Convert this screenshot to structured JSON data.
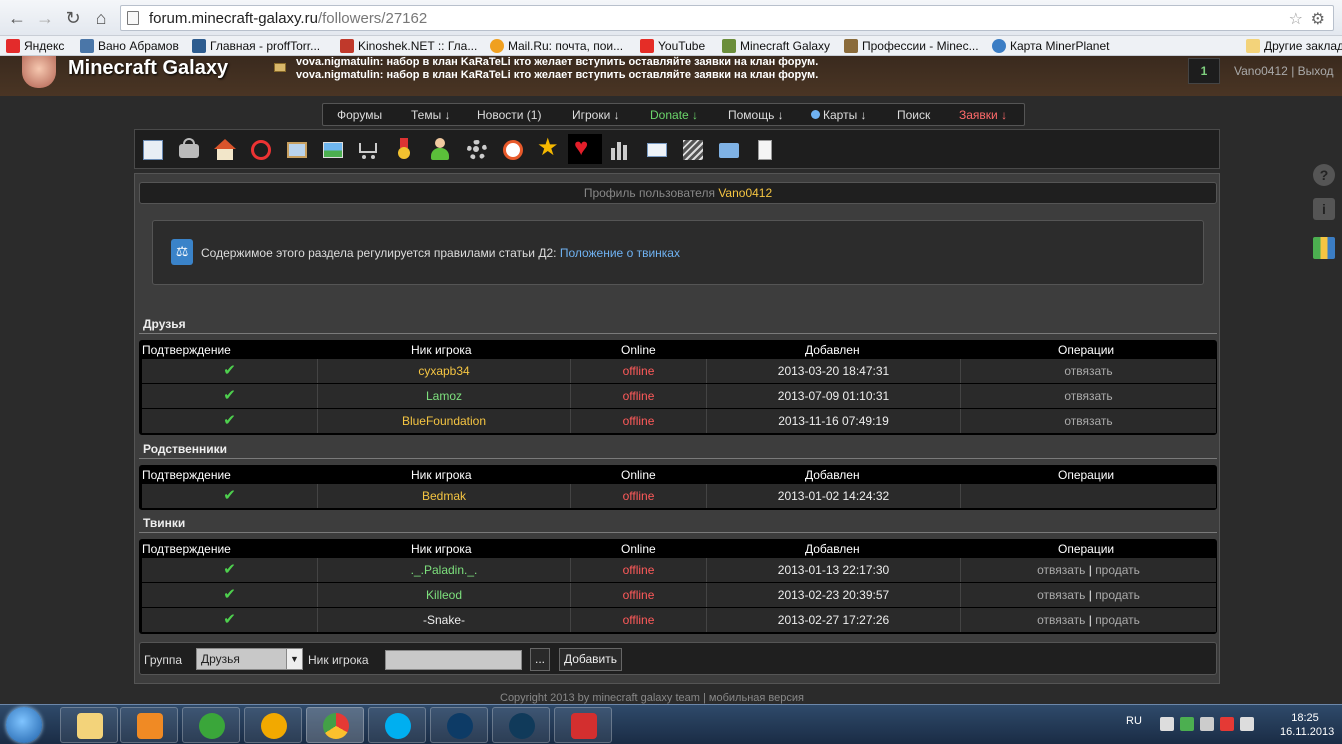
{
  "browser": {
    "url_host": "forum.minecraft-galaxy.ru",
    "url_path": "/followers/27162",
    "bookmarks": [
      {
        "label": "Яндекс",
        "color": "#e32b2b"
      },
      {
        "label": "Вано Абрамов",
        "color": "#4a76a8"
      },
      {
        "label": "Главная - proffTorr...",
        "color": "#2d5c8f"
      },
      {
        "label": "Kinoshek.NET :: Гла...",
        "color": "#c0392b"
      },
      {
        "label": "Mail.Ru: почта, пои...",
        "color": "#f0a020"
      },
      {
        "label": "YouTube",
        "color": "#e52d27"
      },
      {
        "label": "Minecraft Galaxy",
        "color": "#6b8e3b"
      },
      {
        "label": "Профессии - Minec...",
        "color": "#8a6b3b"
      },
      {
        "label": "Карта MinerPlanet",
        "color": "#3b7dc4"
      }
    ],
    "other_bookmarks": "Другие заклад"
  },
  "site": {
    "logo": "Minecraft Galaxy",
    "news": [
      "vova.nigmatulin: набор в клан KaRaTeLi кто желает вступить оставляйте заявки на клан форум.",
      "vova.nigmatulin: набор в клан KaRaTeLi кто желает вступить оставляйте заявки на клан форум."
    ],
    "notify_count": "1",
    "username": "Vano0412",
    "separator": "|",
    "logout": "Выход"
  },
  "nav": {
    "forums": "Форумы",
    "topics": "Темы ↓",
    "news": "Новости (1)",
    "players": "Игроки ↓",
    "donate": "Donate ↓",
    "help": "Помощь ↓",
    "maps": "Карты ↓",
    "search": "Поиск",
    "requests": "Заявки ↓"
  },
  "icons": [
    "profile-card-icon",
    "lock-icon",
    "home-icon",
    "ban-icon",
    "picture-frame-icon",
    "landscape-icon",
    "cart-icon",
    "medal-icon",
    "user-icon",
    "gear-icon",
    "clock-icon",
    "star-icon",
    "heart-icon",
    "stats-icon",
    "mail-icon",
    "notes-icon",
    "folder-icon",
    "document-icon"
  ],
  "profile": {
    "label": "Профиль пользователя",
    "name": "Vano0412"
  },
  "notice": {
    "text": "Содержимое этого раздела регулируется правилами статьи Д2:",
    "link": "Положение о твинках"
  },
  "columns": {
    "confirm": "Подтверждение",
    "nick": "Ник игрока",
    "online": "Online",
    "added": "Добавлен",
    "ops": "Операции"
  },
  "sections": {
    "friends": {
      "title": "Друзья",
      "rows": [
        {
          "nick": "cyxapb34",
          "status": "offline",
          "added": "2013-03-20 18:47:31",
          "op1": "отвязать"
        },
        {
          "nick": "Lamoz",
          "status": "offline",
          "added": "2013-07-09 01:10:31",
          "op1": "отвязать"
        },
        {
          "nick": "BlueFoundation",
          "status": "offline",
          "added": "2013-11-16 07:49:19",
          "op1": "отвязать"
        }
      ]
    },
    "relatives": {
      "title": "Родственники",
      "rows": [
        {
          "nick": "Bedmak",
          "status": "offline",
          "added": "2013-01-02 14:24:32"
        }
      ]
    },
    "twinks": {
      "title": "Твинки",
      "rows": [
        {
          "nick": "._.Paladin._.",
          "status": "offline",
          "added": "2013-01-13 22:17:30",
          "op1": "отвязать",
          "sep": "|",
          "op2": "продать"
        },
        {
          "nick": "Killeod",
          "status": "offline",
          "added": "2013-02-23 20:39:57",
          "op1": "отвязать",
          "sep": "|",
          "op2": "продать"
        },
        {
          "nick": "-Snake-",
          "status": "offline",
          "added": "2013-02-27 17:27:26",
          "op1": "отвязать",
          "sep": "|",
          "op2": "продать"
        }
      ]
    }
  },
  "form": {
    "group_label": "Группа",
    "group_value": "Друзья",
    "nick_label": "Ник игрока",
    "browse": "...",
    "add": "Добавить"
  },
  "footer": {
    "copyright": "Copyright 2013 by minecraft galaxy team",
    "sep": "|",
    "mobile": "мобильная версия"
  },
  "taskbar": {
    "lang": "RU",
    "time": "18:25",
    "date": "16.11.2013"
  }
}
